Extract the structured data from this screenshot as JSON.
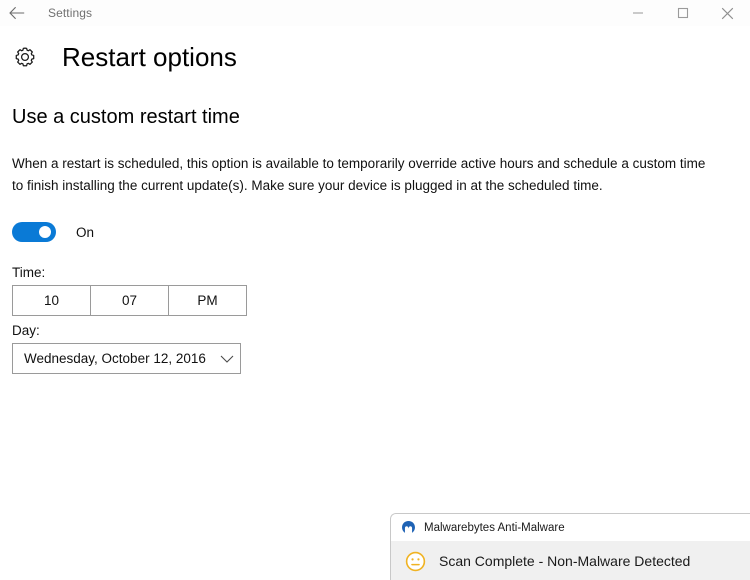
{
  "titlebar": {
    "back_icon": "back-arrow-icon",
    "title": "Settings",
    "minimize_label": "Minimize",
    "maximize_label": "Maximize",
    "close_label": "Close"
  },
  "page": {
    "icon": "gear-icon",
    "title": "Restart options",
    "section_title": "Use a custom restart time",
    "description": "When a restart is scheduled, this option is available to temporarily override active hours and schedule a custom time to finish installing the current update(s). Make sure your device is plugged in at the scheduled time."
  },
  "toggle": {
    "state_label": "On",
    "checked": true,
    "accent_color": "#0a7ad6"
  },
  "time": {
    "label": "Time:",
    "hour": "10",
    "minute": "07",
    "meridiem": "PM"
  },
  "day": {
    "label": "Day:",
    "value": "Wednesday, October 12, 2016",
    "chevron_icon": "chevron-down-icon"
  },
  "notification": {
    "app_icon": "malwarebytes-logo-icon",
    "app_name": "Malwarebytes Anti-Malware",
    "status_icon": "neutral-face-icon",
    "message": "Scan Complete  -  Non-Malware Detected",
    "status_color": "#f0b323"
  }
}
